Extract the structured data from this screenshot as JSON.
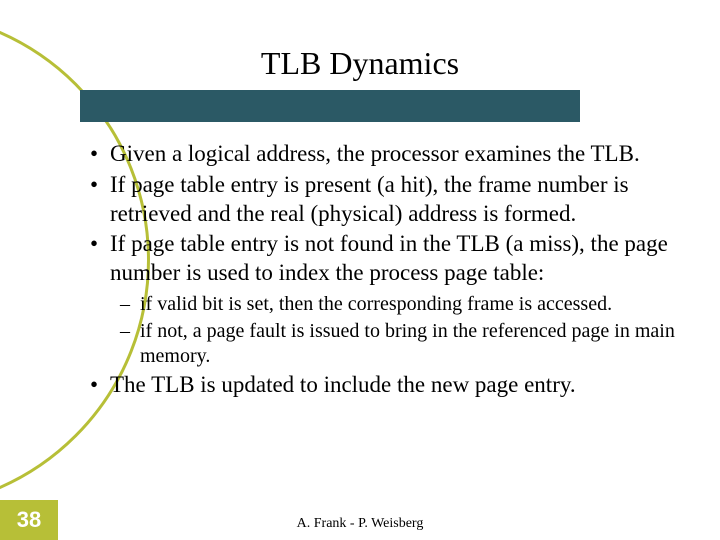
{
  "title": "TLB Dynamics",
  "bullets": {
    "b1": "Given a logical address, the processor examines the TLB.",
    "b2": "If page table entry is present (a hit), the frame number is retrieved and the real (physical) address is formed.",
    "b3": "If page table entry is not found in the TLB (a miss), the page number is used to index the process page table:",
    "b3_sub1": "if valid bit is set, then the corresponding frame is accessed.",
    "b3_sub2": "if not, a page fault is issued to bring in the referenced page in main memory.",
    "b4": "The TLB is updated to include the new page entry."
  },
  "footer": "A. Frank - P. Weisberg",
  "slide_number": "38",
  "colors": {
    "accent_bar": "#2b5965",
    "olive": "#b7bf37"
  }
}
